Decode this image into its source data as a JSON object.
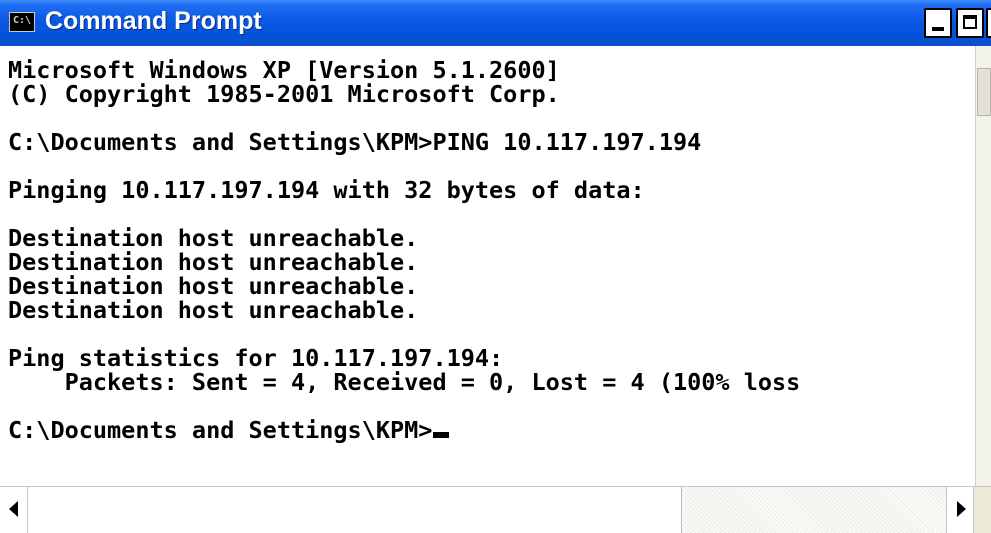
{
  "window": {
    "title": "Command Prompt",
    "icon_label": "C:\\"
  },
  "console": {
    "lines": [
      "Microsoft Windows XP [Version 5.1.2600]",
      "(C) Copyright 1985-2001 Microsoft Corp.",
      "",
      "C:\\Documents and Settings\\KPM>PING 10.117.197.194",
      "",
      "Pinging 10.117.197.194 with 32 bytes of data:",
      "",
      "Destination host unreachable.",
      "Destination host unreachable.",
      "Destination host unreachable.",
      "Destination host unreachable.",
      "",
      "Ping statistics for 10.117.197.194:",
      "    Packets: Sent = 4, Received = 0, Lost = 4 (100% loss",
      "",
      "C:\\Documents and Settings\\KPM>"
    ]
  },
  "icons": {
    "app": "cmd-icon",
    "minimize": "minimize-icon",
    "maximize": "maximize-icon",
    "close": "close-icon",
    "scroll_left": "arrow-left-icon",
    "scroll_right": "arrow-right-icon"
  },
  "colors": {
    "titlebar": "#0a58e3",
    "title_text": "#ffffff",
    "console_bg": "#ffffff",
    "console_text": "#000000"
  }
}
